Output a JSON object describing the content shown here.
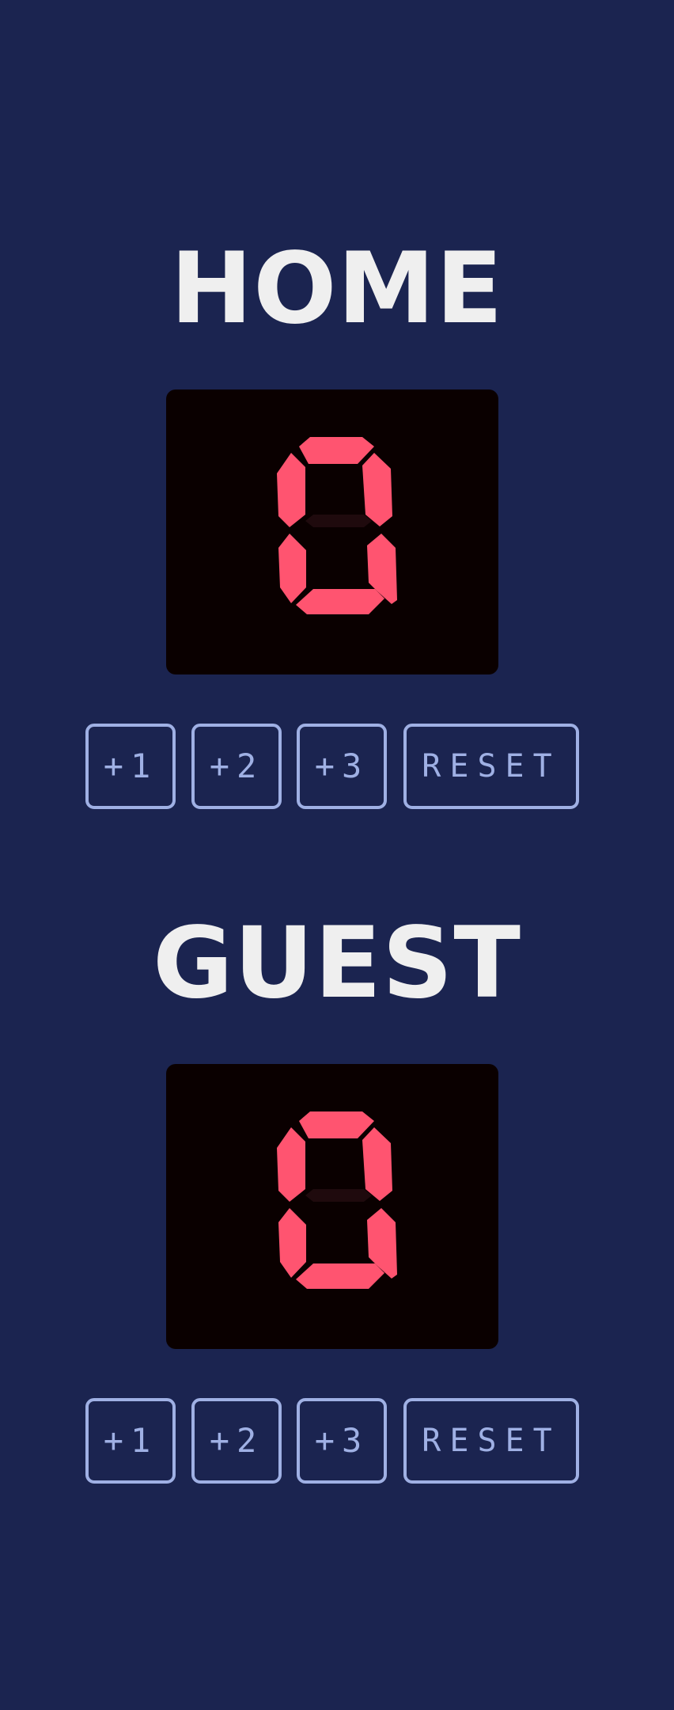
{
  "scoreboard": {
    "home": {
      "title": "HOME",
      "score": "0",
      "buttons": {
        "plus1": "+1",
        "plus2": "+2",
        "plus3": "+3",
        "reset": "RESET"
      }
    },
    "guest": {
      "title": "GUEST",
      "score": "0",
      "buttons": {
        "plus1": "+1",
        "plus2": "+2",
        "plus3": "+3",
        "reset": "RESET"
      }
    }
  },
  "colors": {
    "background": "#1b2450",
    "title": "#efefef",
    "display_bg": "#0a0000",
    "digit": "#ff5470",
    "button_outline": "#9fb0e4"
  }
}
